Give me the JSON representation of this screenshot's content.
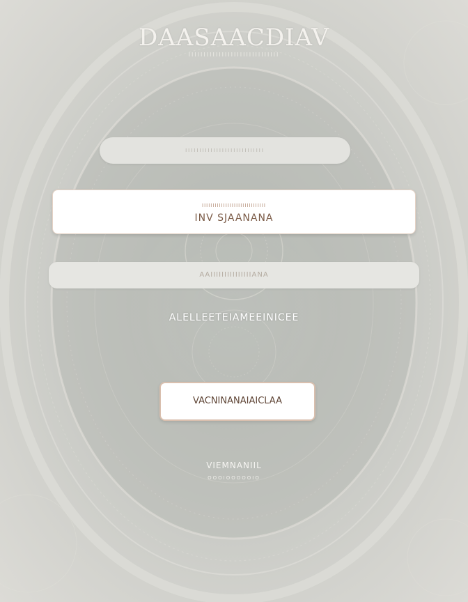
{
  "brand": {
    "title": "DAASAACDIAV",
    "subtitle": "IIIIIIIIIIIIIIIIIIIIIIIIIIIIII"
  },
  "form": {
    "top_field": {
      "placeholder": "IIIIIIIIIIIIIIIIIIIIIIIIIIII"
    },
    "main_field": {
      "dots": "IIIIIIIIIIIIIIIIIIIIIIIIIIIIII",
      "value": "INV SJAANANA"
    },
    "bottom_field": {
      "placeholder": "AAIIIIIIIIIIIIIIIANA"
    }
  },
  "link": {
    "label": "ALELLEETEIAMEEINICEE"
  },
  "action_button": {
    "label": "VACNINANAIAICLAA"
  },
  "footer": {
    "title": "VIEMNANIIL",
    "subtitle": "OOOIOOOOOIO"
  },
  "colors": {
    "background": "#c6c8c3",
    "accent_border": "#d9bfae",
    "accent_text": "#7a5a46"
  }
}
